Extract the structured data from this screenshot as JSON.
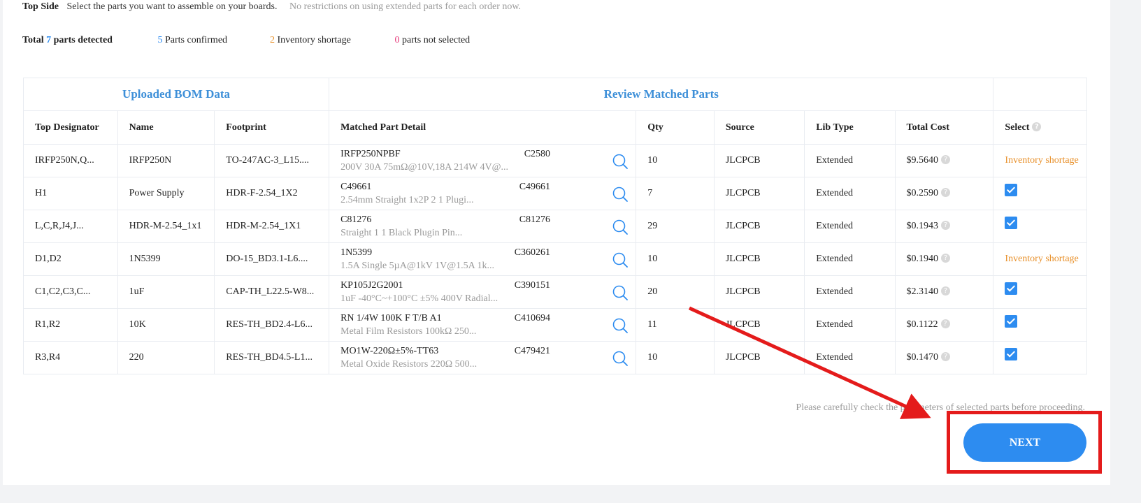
{
  "header": {
    "side_label": "Top Side",
    "description": "Select the parts you want to assemble on your boards.",
    "note": "No restrictions on using extended parts for each order now."
  },
  "summary": {
    "total_prefix": "Total",
    "total_count": "7",
    "total_suffix": "parts detected",
    "confirmed_count": "5",
    "confirmed_label": "Parts confirmed",
    "shortage_count": "2",
    "shortage_label": "Inventory shortage",
    "not_selected_count": "0",
    "not_selected_label": "parts not selected"
  },
  "table": {
    "group_headers": [
      "Uploaded BOM Data",
      "Review Matched Parts"
    ],
    "columns": [
      "Top Designator",
      "Name",
      "Footprint",
      "Matched Part Detail",
      "Qty",
      "Source",
      "Lib Type",
      "Total Cost",
      "Select"
    ],
    "rows": [
      {
        "designator": "IRFP250N,Q...",
        "name": "IRFP250N",
        "footprint": "TO-247AC-3_L15....",
        "part": "IRFP250NPBF",
        "code": "C2580",
        "desc": "200V 30A 75mΩ@10V,18A 214W 4V@...",
        "qty": "10",
        "source": "JLCPCB",
        "lib": "Extended",
        "cost": "$9.5640",
        "select": "Inventory shortage",
        "selected": false
      },
      {
        "designator": "H1",
        "name": "Power Supply",
        "footprint": "HDR-F-2.54_1X2",
        "part": "C49661",
        "code": "C49661",
        "desc": "2.54mm Straight 1x2P 2 1 Plugi...",
        "qty": "7",
        "source": "JLCPCB",
        "lib": "Extended",
        "cost": "$0.2590",
        "select": "",
        "selected": true
      },
      {
        "designator": "L,C,R,J4,J...",
        "name": "HDR-M-2.54_1x1",
        "footprint": "HDR-M-2.54_1X1",
        "part": "C81276",
        "code": "C81276",
        "desc": "Straight 1 1 Black Plugin Pin...",
        "qty": "29",
        "source": "JLCPCB",
        "lib": "Extended",
        "cost": "$0.1943",
        "select": "",
        "selected": true
      },
      {
        "designator": "D1,D2",
        "name": "1N5399",
        "footprint": "DO-15_BD3.1-L6....",
        "part": "1N5399",
        "code": "C360261",
        "desc": "1.5A Single 5µA@1kV 1V@1.5A 1k...",
        "qty": "10",
        "source": "JLCPCB",
        "lib": "Extended",
        "cost": "$0.1940",
        "select": "Inventory shortage",
        "selected": false
      },
      {
        "designator": "C1,C2,C3,C...",
        "name": "1uF",
        "footprint": "CAP-TH_L22.5-W8...",
        "part": "KP105J2G2001",
        "code": "C390151",
        "desc": "1uF -40°C~+100°C ±5% 400V Radial...",
        "qty": "20",
        "source": "JLCPCB",
        "lib": "Extended",
        "cost": "$2.3140",
        "select": "",
        "selected": true
      },
      {
        "designator": "R1,R2",
        "name": "10K",
        "footprint": "RES-TH_BD2.4-L6...",
        "part": "RN 1/4W 100K F T/B A1",
        "code": "C410694",
        "desc": "Metal Film Resistors 100kΩ 250...",
        "qty": "11",
        "source": "JLCPCB",
        "lib": "Extended",
        "cost": "$0.1122",
        "select": "",
        "selected": true
      },
      {
        "designator": "R3,R4",
        "name": "220",
        "footprint": "RES-TH_BD4.5-L1...",
        "part": "MO1W-220Ω±5%-TT63",
        "code": "C479421",
        "desc": "Metal Oxide Resistors 220Ω 500...",
        "qty": "10",
        "source": "JLCPCB",
        "lib": "Extended",
        "cost": "$0.1470",
        "select": "",
        "selected": true
      }
    ]
  },
  "notice": "Please carefully check the parameters of selected parts before proceeding.",
  "next_button": "NEXT",
  "colors": {
    "accent": "#2d8cf0",
    "warning": "#e8902a",
    "annotation": "#e41b1b"
  }
}
